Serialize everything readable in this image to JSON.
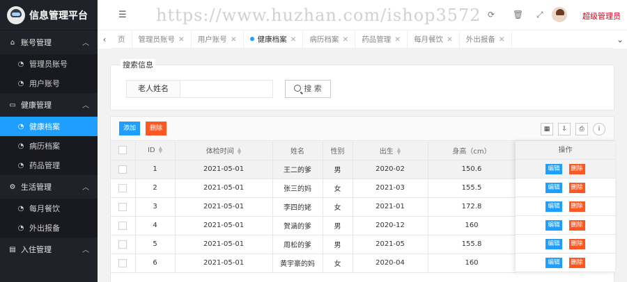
{
  "app": {
    "title": "信息管理平台"
  },
  "sidebar": {
    "groups": [
      {
        "label": "账号管理",
        "icon": "home-icon",
        "items": [
          {
            "label": "管理员账号",
            "icon": "gauge-icon"
          },
          {
            "label": "用户账号",
            "icon": "gauge-icon"
          }
        ]
      },
      {
        "label": "健康管理",
        "icon": "window-icon",
        "items": [
          {
            "label": "健康档案",
            "icon": "gauge-icon",
            "active": true
          },
          {
            "label": "病历档案",
            "icon": "gauge-icon"
          },
          {
            "label": "药品管理",
            "icon": "gauge-icon"
          }
        ]
      },
      {
        "label": "生活管理",
        "icon": "cogs-icon",
        "items": [
          {
            "label": "每月餐饮",
            "icon": "gauge-icon"
          },
          {
            "label": "外出报备",
            "icon": "gauge-icon"
          }
        ]
      },
      {
        "label": "入住管理",
        "icon": "file-icon",
        "items": []
      }
    ]
  },
  "header": {
    "watermark": "https://www.huzhan.com/ishop3572",
    "user_name": "超级管理员"
  },
  "tabs": [
    {
      "label": "页"
    },
    {
      "label": "管理员账号"
    },
    {
      "label": "用户账号"
    },
    {
      "label": "健康档案",
      "active": true
    },
    {
      "label": "病历档案"
    },
    {
      "label": "药品管理"
    },
    {
      "label": "每月餐饮"
    },
    {
      "label": "外出报备"
    }
  ],
  "search": {
    "legend": "搜索信息",
    "field_label": "老人姓名",
    "field_value": "",
    "button_label": "搜 索"
  },
  "toolbar": {
    "add_label": "添加",
    "delete_label": "删除"
  },
  "table": {
    "columns": [
      "ID",
      "体检时间",
      "姓名",
      "性别",
      "出生",
      "身高（cm）"
    ],
    "action_header": "操作",
    "edit_label": "编辑",
    "delete_label": "删除",
    "rows": [
      {
        "id": "1",
        "date": "2021-05-01",
        "name": "王二的爹",
        "gender": "男",
        "birth": "2020-02",
        "height": "150.6"
      },
      {
        "id": "2",
        "date": "2021-05-01",
        "name": "张三的妈",
        "gender": "女",
        "birth": "2021-03",
        "height": "155.5"
      },
      {
        "id": "3",
        "date": "2021-05-01",
        "name": "李四的姥",
        "gender": "女",
        "birth": "2021-01",
        "height": "172.8"
      },
      {
        "id": "4",
        "date": "2021-05-01",
        "name": "贺涵的爹",
        "gender": "男",
        "birth": "2020-12",
        "height": "160"
      },
      {
        "id": "5",
        "date": "2021-05-01",
        "name": "周松的爹",
        "gender": "男",
        "birth": "2021-05",
        "height": "155.8"
      },
      {
        "id": "6",
        "date": "2021-05-01",
        "name": "黄宇豪的妈",
        "gender": "女",
        "birth": "2020-04",
        "height": "160"
      }
    ]
  }
}
